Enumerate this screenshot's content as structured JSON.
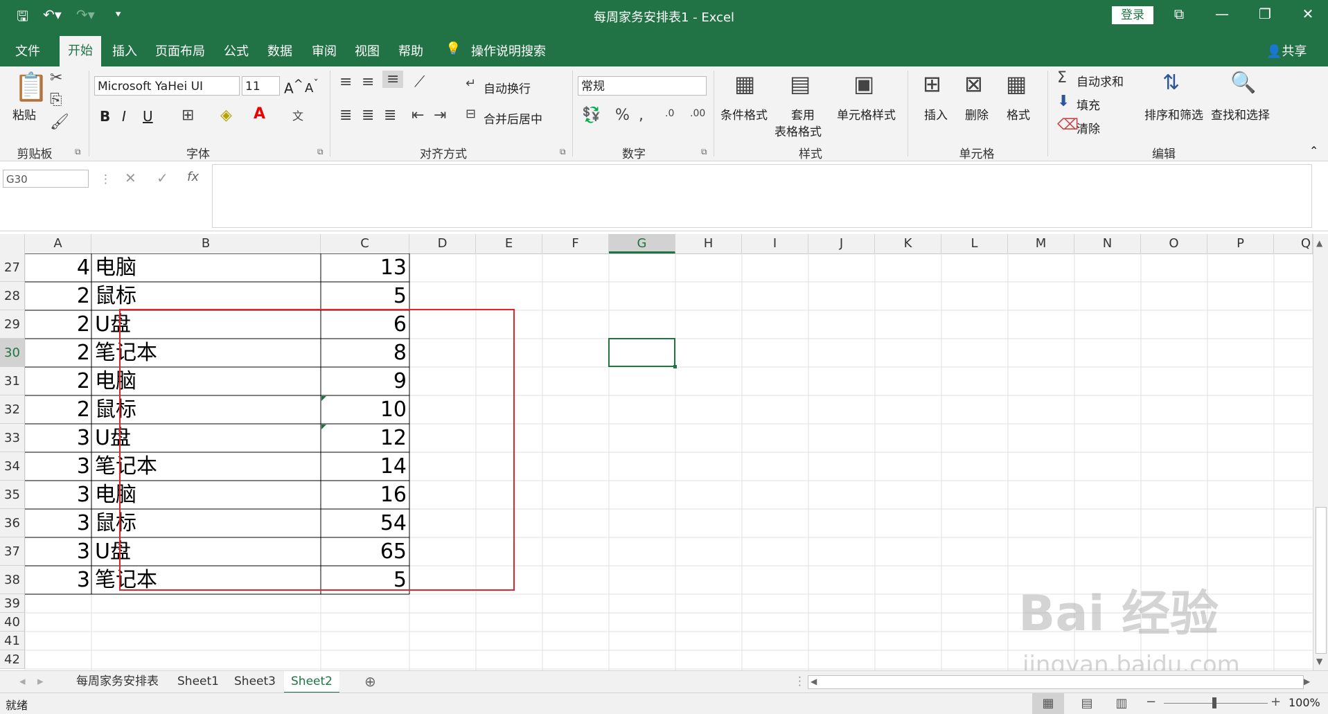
{
  "titlebar": {
    "title": "每周家务安排表1  -  Excel",
    "login": "登录"
  },
  "tabs": [
    "文件",
    "开始",
    "插入",
    "页面布局",
    "公式",
    "数据",
    "审阅",
    "视图",
    "帮助"
  ],
  "search_label": "操作说明搜索",
  "share_label": "共享",
  "ribbon": {
    "paste": "粘贴",
    "clipboard": "剪贴板",
    "font_name": "Microsoft YaHei UI",
    "font_size": "11",
    "font_group": "字体",
    "bold": "B",
    "italic": "I",
    "underline": "U",
    "wrap": "自动换行",
    "merge": "合并后居中",
    "align_group": "对齐方式",
    "number_format": "常规",
    "number_group": "数字",
    "cond_format": "条件格式",
    "table_format_1": "套用",
    "table_format_2": "表格格式",
    "cell_style": "单元格样式",
    "style_group": "样式",
    "insert": "插入",
    "delete": "删除",
    "format": "格式",
    "cells_group": "单元格",
    "autosum": "自动求和",
    "fill": "填充",
    "clear": "清除",
    "sort": "排序和筛选",
    "find": "查找和选择",
    "edit_group": "编辑"
  },
  "namebox": "G30",
  "columns": [
    "A",
    "B",
    "C",
    "D",
    "E",
    "F",
    "G",
    "H",
    "I",
    "J",
    "K",
    "L",
    "M",
    "N",
    "O",
    "P",
    "Q"
  ],
  "rows": [
    {
      "num": "27",
      "a": "4",
      "b": "电脑",
      "c": "13"
    },
    {
      "num": "28",
      "a": "2",
      "b": "鼠标",
      "c": "5"
    },
    {
      "num": "29",
      "a": "2",
      "b": "U盘",
      "c": "6"
    },
    {
      "num": "30",
      "a": "2",
      "b": "笔记本",
      "c": "8"
    },
    {
      "num": "31",
      "a": "2",
      "b": "电脑",
      "c": "9"
    },
    {
      "num": "32",
      "a": "2",
      "b": "鼠标",
      "c": "10"
    },
    {
      "num": "33",
      "a": "3",
      "b": "U盘",
      "c": "12"
    },
    {
      "num": "34",
      "a": "3",
      "b": "笔记本",
      "c": "14"
    },
    {
      "num": "35",
      "a": "3",
      "b": "电脑",
      "c": "16"
    },
    {
      "num": "36",
      "a": "3",
      "b": "鼠标",
      "c": "54"
    },
    {
      "num": "37",
      "a": "3",
      "b": "U盘",
      "c": "65"
    },
    {
      "num": "38",
      "a": "3",
      "b": "笔记本",
      "c": "5"
    }
  ],
  "empty_rows": [
    "39",
    "40",
    "41",
    "42"
  ],
  "sheets": [
    "每周家务安排表",
    "Sheet1",
    "Sheet3",
    "Sheet2"
  ],
  "status": {
    "ready": "就绪",
    "zoom": "100%"
  },
  "watermark": {
    "brand": "Bai 经验",
    "url": "jingyan.baidu.com"
  }
}
